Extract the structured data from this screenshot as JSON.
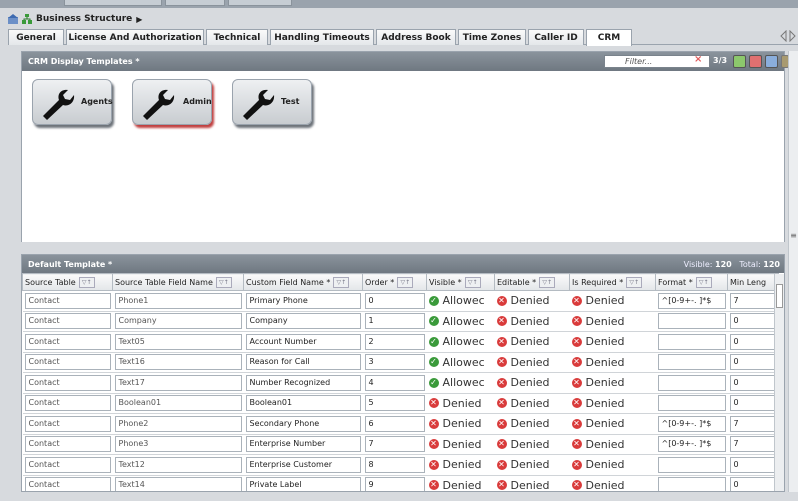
{
  "breadcrumb": {
    "title": "Business Structure",
    "arrow": "▶"
  },
  "tabs": [
    "General",
    "License And Authorization",
    "Technical",
    "Handling Timeouts",
    "Address Book",
    "Time Zones",
    "Caller ID",
    "CRM"
  ],
  "active_tab": "CRM",
  "templates_panel": {
    "title": "CRM Display Templates *",
    "filter_placeholder": "Filter...",
    "clear": "×",
    "count": "3/3",
    "templates": [
      "Agents",
      "Admin",
      "Test"
    ],
    "selected": "Admin"
  },
  "default_panel": {
    "title": "Default Template *",
    "visible_label": "Visible:",
    "visible_count": "120",
    "total_label": "Total:",
    "total_count": "120",
    "columns": [
      "Source Table",
      "Source Table Field Name",
      "Custom Field Name *",
      "Order *",
      "Visible *",
      "Editable *",
      "Is Required *",
      "Format *",
      "Min Leng"
    ],
    "rows": [
      {
        "source": "Contact",
        "field": "Phone1",
        "custom": "Primary Phone",
        "order": "0",
        "visible": "Allowec",
        "visible_ok": true,
        "editable": "Denied",
        "required": "Denied",
        "format": "^[0-9+-. ]*$",
        "min": "7"
      },
      {
        "source": "Contact",
        "field": "Company",
        "custom": "Company",
        "order": "1",
        "visible": "Allowec",
        "visible_ok": true,
        "editable": "Denied",
        "required": "Denied",
        "format": "",
        "min": "0"
      },
      {
        "source": "Contact",
        "field": "Text05",
        "custom": "Account Number",
        "order": "2",
        "visible": "Allowec",
        "visible_ok": true,
        "editable": "Denied",
        "required": "Denied",
        "format": "",
        "min": "0"
      },
      {
        "source": "Contact",
        "field": "Text16",
        "custom": "Reason for Call",
        "order": "3",
        "visible": "Allowec",
        "visible_ok": true,
        "editable": "Denied",
        "required": "Denied",
        "format": "",
        "min": "0"
      },
      {
        "source": "Contact",
        "field": "Text17",
        "custom": "Number Recognized",
        "order": "4",
        "visible": "Allowec",
        "visible_ok": true,
        "editable": "Denied",
        "required": "Denied",
        "format": "",
        "min": "0"
      },
      {
        "source": "Contact",
        "field": "Boolean01",
        "custom": "Boolean01",
        "order": "5",
        "visible": "Denied",
        "visible_ok": false,
        "editable": "Denied",
        "required": "Denied",
        "format": "",
        "min": "0"
      },
      {
        "source": "Contact",
        "field": "Phone2",
        "custom": "Secondary Phone",
        "order": "6",
        "visible": "Denied",
        "visible_ok": false,
        "editable": "Denied",
        "required": "Denied",
        "format": "^[0-9+-. ]*$",
        "min": "7"
      },
      {
        "source": "Contact",
        "field": "Phone3",
        "custom": "Enterprise Number",
        "order": "7",
        "visible": "Denied",
        "visible_ok": false,
        "editable": "Denied",
        "required": "Denied",
        "format": "^[0-9+-. ]*$",
        "min": "7"
      },
      {
        "source": "Contact",
        "field": "Text12",
        "custom": "Enterprise Customer",
        "order": "8",
        "visible": "Denied",
        "visible_ok": false,
        "editable": "Denied",
        "required": "Denied",
        "format": "",
        "min": "0"
      },
      {
        "source": "Contact",
        "field": "Text14",
        "custom": "Private Label",
        "order": "9",
        "visible": "Denied",
        "visible_ok": false,
        "editable": "Denied",
        "required": "Denied",
        "format": "",
        "min": "0"
      }
    ]
  },
  "colors": {
    "header": "#7a838c",
    "allowed": "#3a9a3a",
    "denied": "#d93b3b",
    "selected_shadow": "#c04040"
  },
  "icons": [
    "home-icon",
    "structure-icon",
    "wrench-icon",
    "add-icon",
    "delete-icon",
    "copy-icon",
    "lock-icon",
    "check-icon",
    "x-icon",
    "sort-filter-icon"
  ]
}
